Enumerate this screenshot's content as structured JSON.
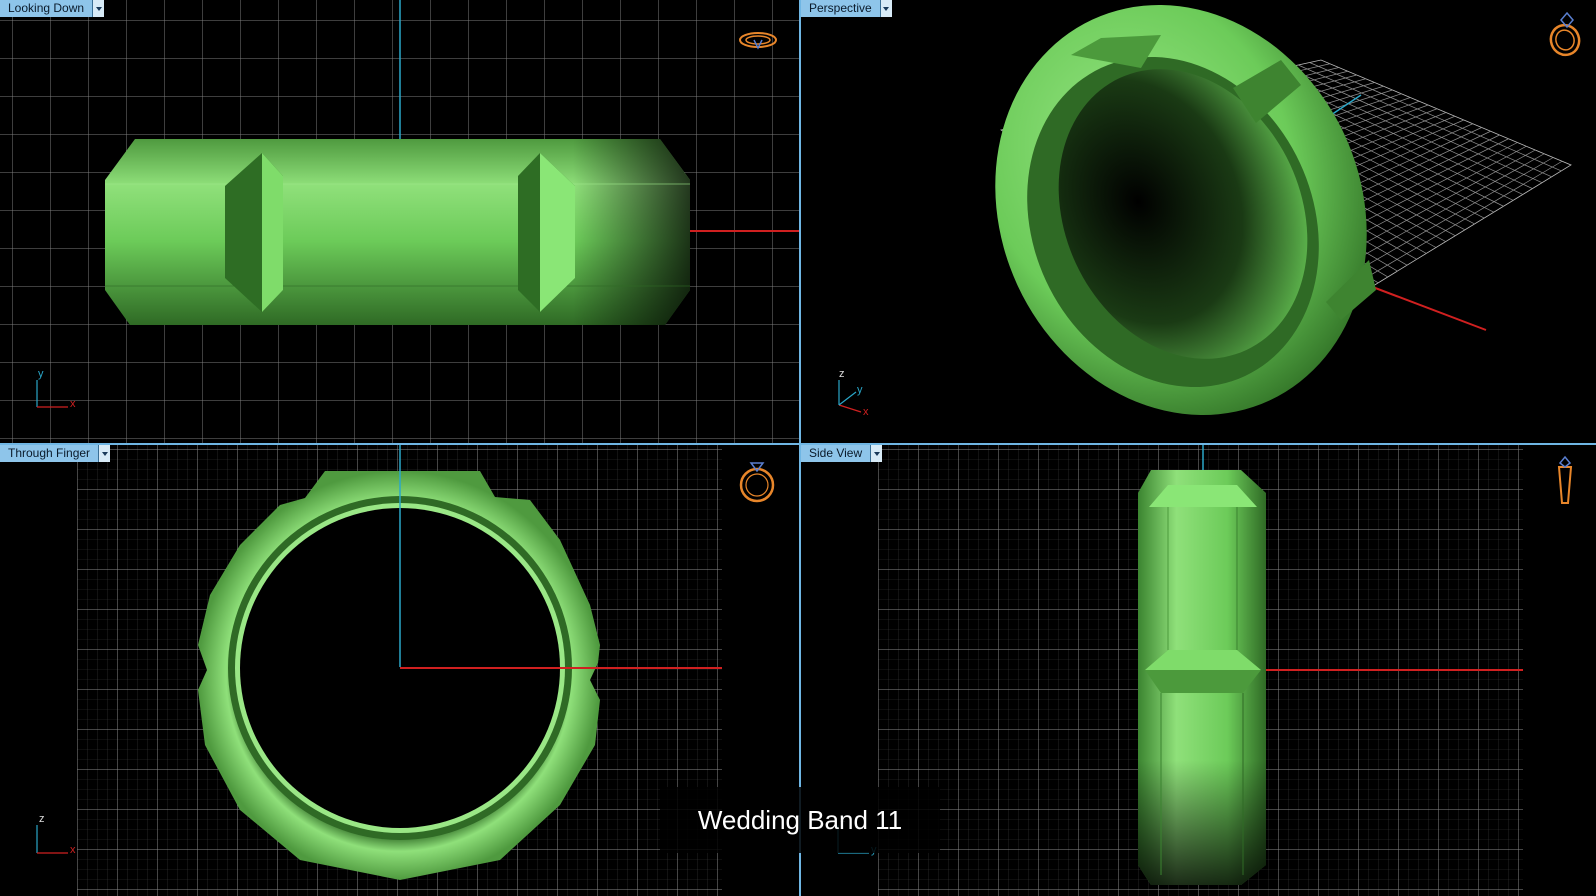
{
  "viewports": {
    "top_left": {
      "label": "Looking Down",
      "axis_v": "y",
      "axis_h": "x"
    },
    "top_right": {
      "label": "Perspective",
      "axis_v": "z",
      "axis_h": "x",
      "axis_d": "y"
    },
    "bottom_left": {
      "label": "Through Finger",
      "axis_v": "z",
      "axis_h": "x"
    },
    "bottom_right": {
      "label": "Side View",
      "axis_v": "z",
      "axis_h": "y"
    }
  },
  "caption": "Wedding Band 11",
  "colors": {
    "ring_green": "#6fcf5e",
    "axis_red": "#d02020",
    "axis_blue": "#2aa7c9",
    "grid": "#8a8a8a",
    "label_bg": "#8ec5ea",
    "icon_orange": "#e8862a"
  },
  "icons": {
    "top_left": "ring-top-view-icon",
    "top_right": "ring-perspective-icon",
    "bottom_left": "ring-front-view-icon",
    "bottom_right": "ring-side-view-icon"
  }
}
